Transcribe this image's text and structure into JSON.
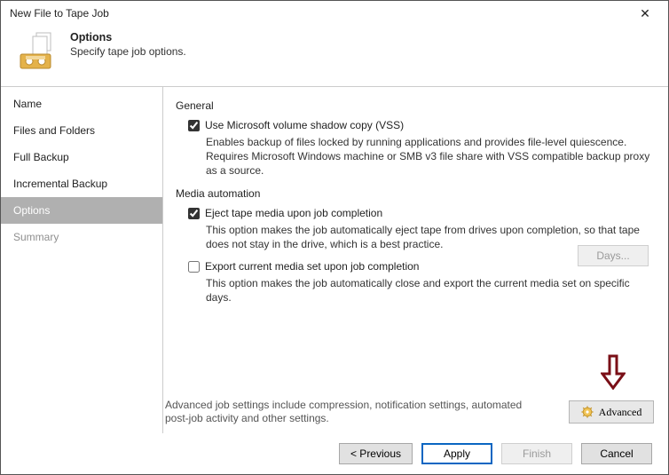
{
  "window": {
    "title": "New File to Tape Job",
    "close_glyph": "✕"
  },
  "header": {
    "heading": "Options",
    "subtitle": "Specify tape job options."
  },
  "sidebar": {
    "items": [
      {
        "label": "Name",
        "selected": false
      },
      {
        "label": "Files and Folders",
        "selected": false
      },
      {
        "label": "Full Backup",
        "selected": false
      },
      {
        "label": "Incremental Backup",
        "selected": false
      },
      {
        "label": "Options",
        "selected": true
      },
      {
        "label": "Summary",
        "selected": false,
        "dim": true
      }
    ]
  },
  "content": {
    "general": {
      "title": "General",
      "vss": {
        "label": "Use Microsoft volume shadow copy (VSS)",
        "checked": true,
        "desc": "Enables backup of files locked by running applications and provides file-level quiescence. Requires Microsoft Windows machine or SMB v3 file share with VSS compatible backup proxy as a source."
      }
    },
    "media": {
      "title": "Media automation",
      "eject": {
        "label": "Eject tape media upon job completion",
        "checked": true,
        "desc": "This option makes the job automatically eject tape from drives upon completion, so that tape does not stay in the drive, which is a best practice."
      },
      "export": {
        "label": "Export current media set upon job completion",
        "checked": false,
        "desc": "This option makes the job automatically close and export the current media set on specific days."
      },
      "days_button": "Days..."
    },
    "advanced": {
      "text": "Advanced job settings include compression, notification settings, automated post-job activity and other settings.",
      "button": "Advanced"
    }
  },
  "footer": {
    "previous": "< Previous",
    "apply": "Apply",
    "finish": "Finish",
    "cancel": "Cancel"
  }
}
